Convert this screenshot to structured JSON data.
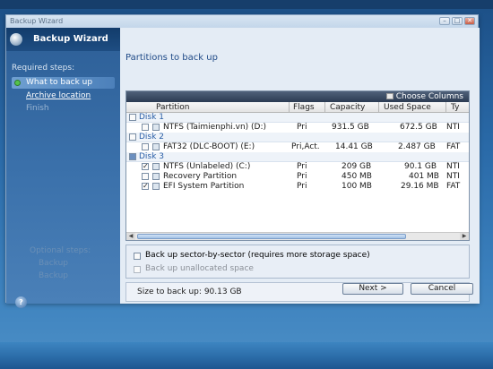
{
  "window": {
    "title": "Backup Wizard"
  },
  "sidebar": {
    "title": "Backup Wizard",
    "required_label": "Required steps:",
    "steps": [
      {
        "label": "What to back up",
        "state": "active"
      },
      {
        "label": "Archive location",
        "state": "link"
      },
      {
        "label": "Finish",
        "state": "disabled"
      }
    ],
    "optional_label": "Optional steps:",
    "optional_items": [
      "Backup",
      "Backup"
    ]
  },
  "main": {
    "title": "Partitions to back up",
    "choose_columns": "Choose Columns",
    "columns": [
      "Partition",
      "Flags",
      "Capacity",
      "Used Space",
      "Ty"
    ],
    "disks": [
      {
        "name": "Disk 1",
        "checked": false,
        "partitions": [
          {
            "name": "NTFS (Taimienphi.vn) (D:)",
            "flags": "Pri",
            "capacity": "931.5 GB",
            "used": "672.5 GB",
            "type": "NTI",
            "checked": false
          }
        ]
      },
      {
        "name": "Disk 2",
        "checked": false,
        "partitions": [
          {
            "name": "FAT32 (DLC-BOOT) (E:)",
            "flags": "Pri,Act.",
            "capacity": "14.41 GB",
            "used": "2.487 GB",
            "type": "FAT",
            "checked": false
          }
        ]
      },
      {
        "name": "Disk 3",
        "checked": true,
        "partitions": [
          {
            "name": "NTFS (Unlabeled) (C:)",
            "flags": "Pri",
            "capacity": "209 GB",
            "used": "90.1 GB",
            "type": "NTI",
            "checked": true
          },
          {
            "name": "Recovery Partition",
            "flags": "Pri",
            "capacity": "450 MB",
            "used": "401 MB",
            "type": "NTI",
            "checked": false
          },
          {
            "name": "EFI System Partition",
            "flags": "Pri",
            "capacity": "100 MB",
            "used": "29.16 MB",
            "type": "FAT",
            "checked": true
          }
        ]
      }
    ],
    "options": {
      "sector_by_sector": "Back up sector-by-sector (requires more storage space)",
      "unallocated": "Back up unallocated space"
    },
    "size_label": "Size to back up:",
    "size_value": "90.13 GB"
  },
  "buttons": {
    "next": "Next >",
    "cancel": "Cancel"
  }
}
